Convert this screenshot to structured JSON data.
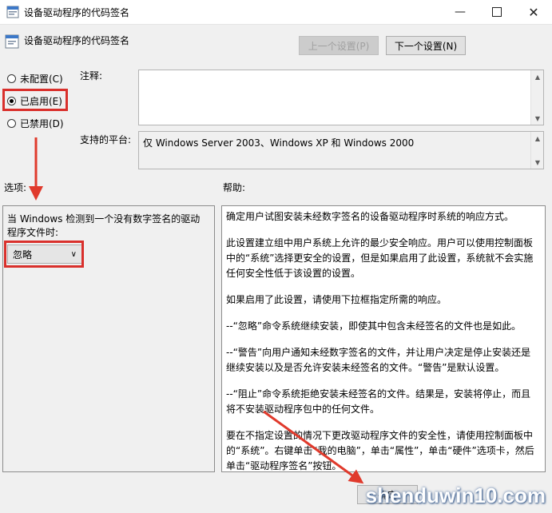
{
  "window": {
    "title": "设备驱动程序的代码签名"
  },
  "header": {
    "title": "设备驱动程序的代码签名"
  },
  "nav": {
    "prev_label": "上一个设置(P)",
    "next_label": "下一个设置(N)"
  },
  "radios": [
    {
      "label": "未配置(C)",
      "checked": false
    },
    {
      "label": "已启用(E)",
      "checked": true
    },
    {
      "label": "已禁用(D)",
      "checked": false
    }
  ],
  "comment": {
    "label": "注释:",
    "value": ""
  },
  "platform": {
    "label": "支持的平台:",
    "value": "仅 Windows Server 2003、Windows XP 和 Windows 2000"
  },
  "options": {
    "label": "选项:",
    "description": "当 Windows 检测到一个没有数字签名的驱动程序文件时:",
    "selected": "忽略"
  },
  "help": {
    "label": "帮助:",
    "paragraphs": [
      "确定用户试图安装未经数字签名的设备驱动程序时系统的响应方式。",
      "此设置建立组中用户系统上允许的最少安全响应。用户可以使用控制面板中的“系统”选择更安全的设置，但是如果启用了此设置，系统就不会实施任何安全性低于该设置的设置。",
      "如果启用了此设置，请使用下拉框指定所需的响应。",
      "--“忽略”命令系统继续安装，即使其中包含未经签名的文件也是如此。",
      "--“警告”向用户通知未经数字签名的文件，并让用户决定是停止安装还是继续安装以及是否允许安装未经签名的文件。“警告”是默认设置。",
      "--“阻止”命令系统拒绝安装未经签名的文件。结果是，安装将停止，而且将不安装驱动程序包中的任何文件。",
      "要在不指定设置的情况下更改驱动程序文件的安全性，请使用控制面板中的“系统”。右键单击“我的电脑”，单击“属性”，单击“硬件”选项卡，然后单击“驱动程序签名”按钮。"
    ]
  },
  "footer": {
    "ok_label": "确定"
  },
  "watermark": "shenduwin10.com",
  "colors": {
    "highlight_red": "#d9302c",
    "arrow_red": "#e03a2c"
  }
}
